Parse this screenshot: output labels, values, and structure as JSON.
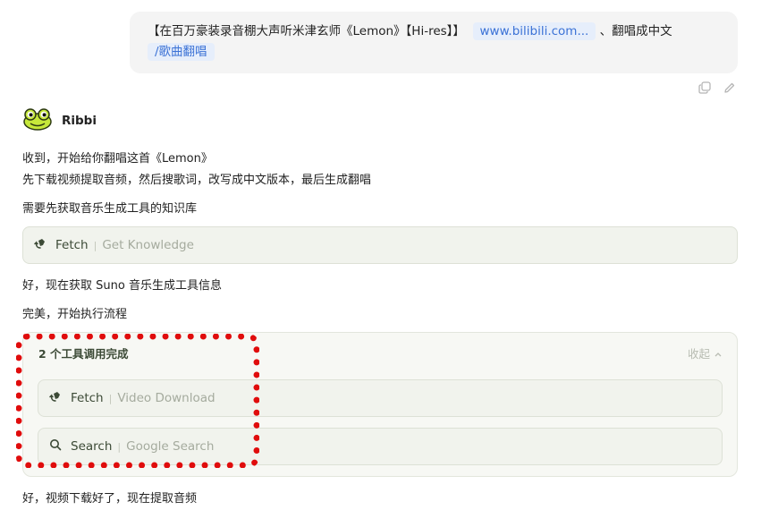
{
  "user_message": {
    "text": "【在百万豪装录音棚大声听米津玄师《Lemon》【Hi-res】】",
    "link": "www.bilibili.com...",
    "suffix": "、翻唱成中文",
    "command": "/歌曲翻唱"
  },
  "bot": {
    "name": "Ribbi"
  },
  "messages": {
    "m1": "收到，开始给你翻唱这首《Lemon》",
    "m2": "先下载视频提取音频，然后搜歌词，改写成中文版本，最后生成翻唱",
    "m3": "需要先获取音乐生成工具的知识库",
    "m4": "好，现在获取 Suno 音乐生成工具信息",
    "m5": "完美，开始执行流程",
    "m6": "好，视频下载好了，现在提取音频"
  },
  "tool_knowledge": {
    "name": "Fetch",
    "desc": "Get Knowledge",
    "icon": "fetch-icon"
  },
  "tool_group": {
    "title": "2 个工具调用完成",
    "collapse_label": "收起",
    "tools": [
      {
        "name": "Fetch",
        "desc": "Video Download",
        "icon": "fetch-icon"
      },
      {
        "name": "Search",
        "desc": "Google Search",
        "icon": "search-icon"
      }
    ]
  },
  "colors": {
    "highlight": "#e00c0c",
    "link": "#3b72d6",
    "tool_bg": "#f1f3ed"
  }
}
